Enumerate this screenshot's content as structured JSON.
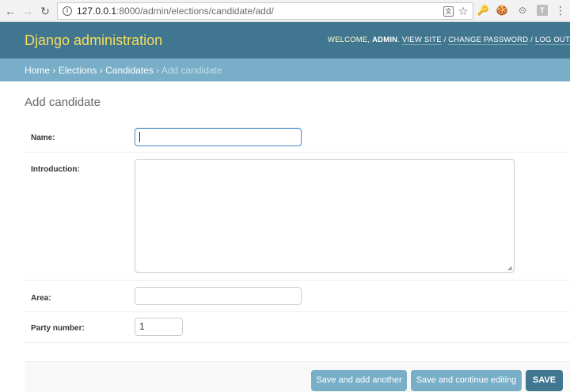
{
  "browser": {
    "url_host": "127.0.0.1",
    "url_rest": ":8000/admin/elections/candidate/add/"
  },
  "header": {
    "branding": "Django administration",
    "welcome": "WELCOME, ",
    "username": "ADMIN",
    "view_site": "VIEW SITE",
    "change_password": "CHANGE PASSWORD",
    "log_out": "LOG OUT"
  },
  "breadcrumbs": {
    "home": "Home",
    "elections": "Elections",
    "candidates": "Candidates",
    "current": "Add candidate",
    "separator": "›"
  },
  "page": {
    "title": "Add candidate"
  },
  "form": {
    "name_label": "Name:",
    "name_value": "",
    "introduction_label": "Introduction:",
    "introduction_value": "",
    "area_label": "Area:",
    "area_value": "",
    "party_number_label": "Party number:",
    "party_number_value": "1"
  },
  "submit": {
    "save_add_another": "Save and add another",
    "save_continue": "Save and continue editing",
    "save": "SAVE"
  },
  "colors": {
    "header_bg": "#417690",
    "breadcrumb_bg": "#79aec8",
    "branding": "#f5dd5d"
  }
}
